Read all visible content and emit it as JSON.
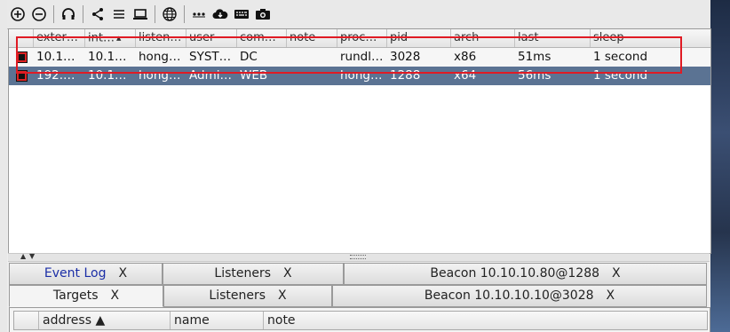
{
  "toolbar": {
    "icons": [
      "connect-icon",
      "disconnect-icon",
      "headset-icon",
      "share-icon",
      "list-icon",
      "laptop-icon",
      "globe-icon",
      "ellipsis-icon",
      "cloud-download-icon",
      "keyboard-icon",
      "camera-icon"
    ]
  },
  "beacons": {
    "columns": [
      "external",
      "internal",
      "listener",
      "user",
      "computer",
      "note",
      "process",
      "pid",
      "arch",
      "last",
      "sleep"
    ],
    "column_display": [
      "exter…",
      "int…",
      "listen…",
      "user",
      "com…",
      "note",
      "proc…",
      "pid",
      "arch",
      "last",
      "sleep"
    ],
    "sort_indicator": "▲",
    "rows": [
      {
        "external": "10.1…",
        "internal": "10.1…",
        "listener": "hong…",
        "user": "SYST…",
        "computer": "DC",
        "note": "",
        "process": "rundl…",
        "pid": "3028",
        "arch": "x86",
        "last": "51ms",
        "sleep": "1 second"
      },
      {
        "external": "192.…",
        "internal": "10.1…",
        "listener": "hong…",
        "user": "Admi…",
        "computer": "WEB",
        "note": "",
        "process": "hong…",
        "pid": "1288",
        "arch": "x64",
        "last": "56ms",
        "sleep": "1 second"
      }
    ]
  },
  "tabs_row1": [
    {
      "label": "Event Log",
      "close": "X"
    },
    {
      "label": "Listeners",
      "close": "X"
    },
    {
      "label": "Beacon 10.10.10.80@1288",
      "close": "X"
    }
  ],
  "tabs_row2": [
    {
      "label": "Targets",
      "close": "X"
    },
    {
      "label": "Listeners",
      "close": "X"
    },
    {
      "label": "Beacon 10.10.10.10@3028",
      "close": "X"
    }
  ],
  "targets_table": {
    "columns": [
      "address ▲",
      "name",
      "note"
    ]
  },
  "colors": {
    "selected_row": "#5b7393",
    "highlight_box": "#e01b24",
    "event_log_text": "#1b2ea6"
  }
}
